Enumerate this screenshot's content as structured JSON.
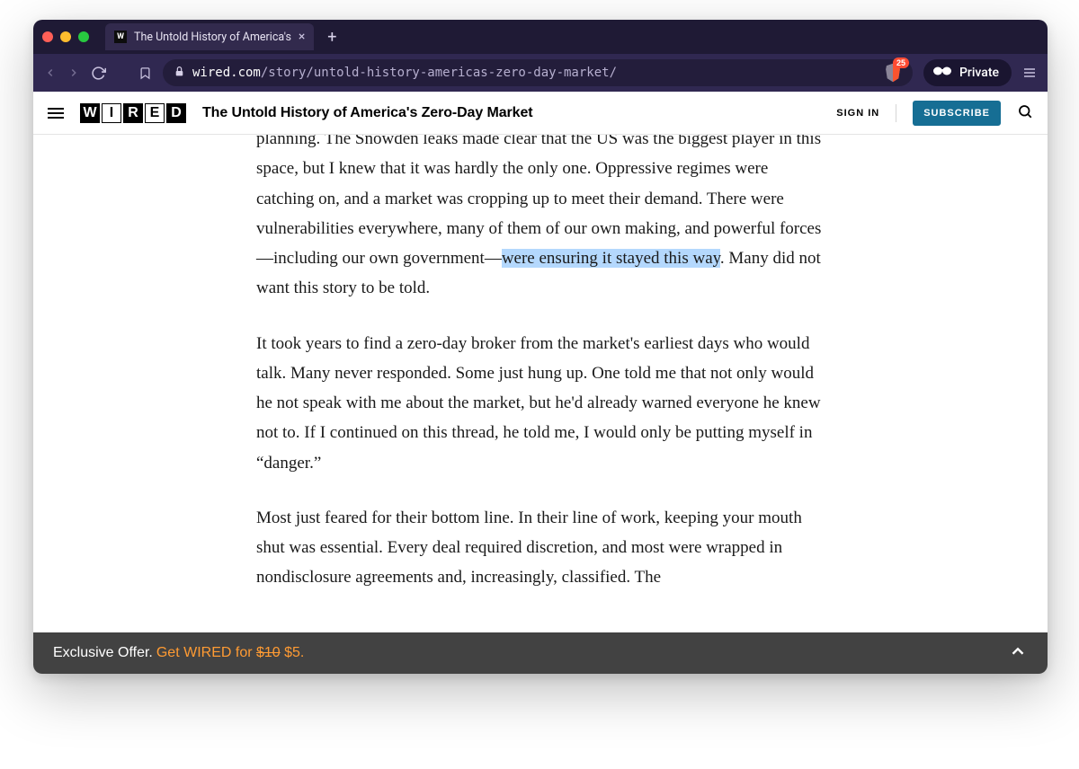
{
  "browser": {
    "tab_title": "The Untold History of America's",
    "url_domain": "wired.com",
    "url_path": "/story/untold-history-americas-zero-day-market/",
    "shield_count": "25",
    "private_label": "Private"
  },
  "site": {
    "logo_letters": [
      "W",
      "I",
      "R",
      "E",
      "D"
    ],
    "article_title": "The Untold History of America's Zero-Day Market",
    "sign_in": "SIGN IN",
    "subscribe": "SUBSCRIBE"
  },
  "article": {
    "p1_a": "planning. The Snowden leaks made clear that the US was the biggest player in this space, but I knew that it was hardly the only one. Oppressive regimes were catching on, and a market was cropping up to meet their demand. There were vulnerabilities everywhere, many of them of our own making, and powerful forces—including our own government—",
    "p1_hl": "were ensuring it stayed this way",
    "p1_b": ". Many did not want this story to be told.",
    "p2": "It took years to find a zero-day broker from the market's earliest days who would talk. Many never responded. Some just hung up. One told me that not only would he not speak with me about the market, but he'd already warned everyone he knew not to. If I continued on this thread, he told me, I would only be putting myself in “danger.”",
    "p3": "Most just feared for their bottom line. In their line of work, keeping your mouth shut was essential. Every deal required discretion, and most were wrapped in nondisclosure agreements and, increasingly, classified. The"
  },
  "promo": {
    "lead": "Exclusive Offer.",
    "offer_prefix": "Get WIRED for ",
    "old_price": "$10",
    "new_price": " $5."
  }
}
